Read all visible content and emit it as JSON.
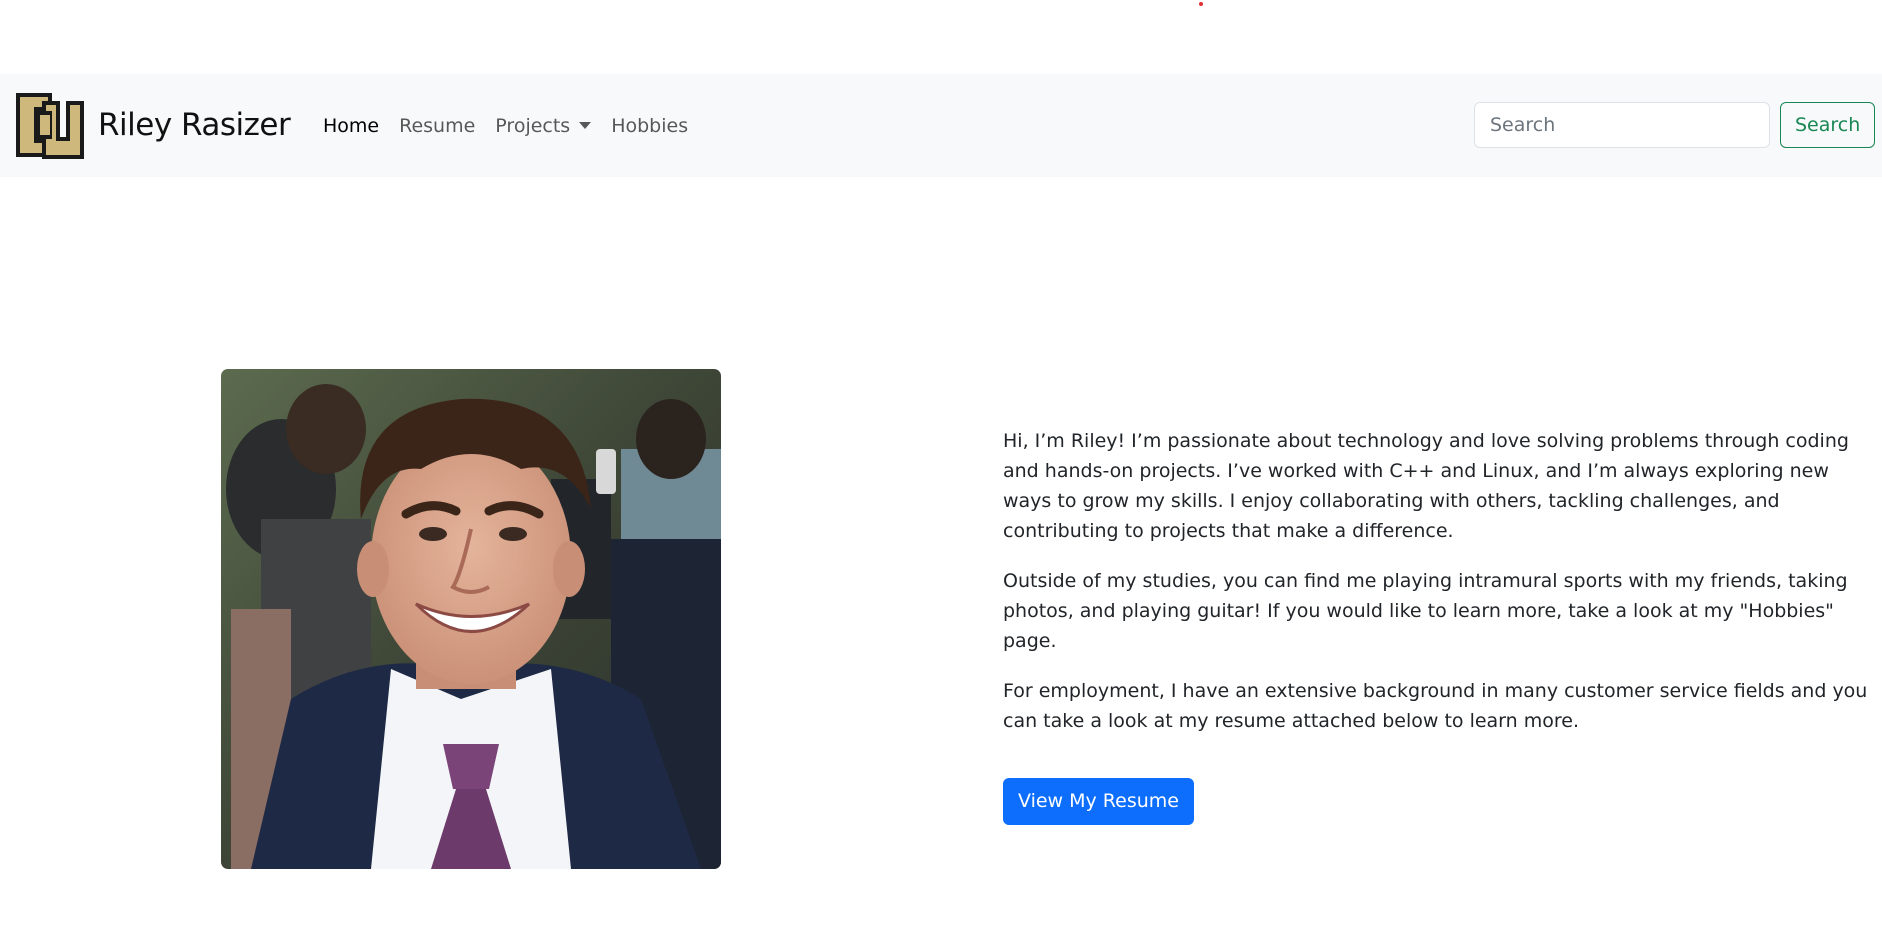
{
  "brand": {
    "name": "Riley Rasizer",
    "logo_icon": "cu-logo-icon"
  },
  "nav": {
    "items": [
      {
        "label": "Home",
        "active": true
      },
      {
        "label": "Resume",
        "active": false
      },
      {
        "label": "Projects",
        "active": false,
        "dropdown": true
      },
      {
        "label": "Hobbies",
        "active": false
      }
    ]
  },
  "search": {
    "placeholder": "Search",
    "value": "",
    "button_label": "Search"
  },
  "about": {
    "paragraphs": [
      "Hi, I’m Riley! I’m passionate about technology and love solving problems through coding and hands-on projects. I’ve worked with C++ and Linux, and I’m always exploring new ways to grow my skills. I enjoy collaborating with others, tackling challenges, and contributing to projects that make a difference.",
      "Outside of my studies, you can find me playing intramural sports with my friends, taking photos, and playing guitar! If you would like to learn more, take a look at my \"Hobbies\" page.",
      "For employment, I have an extensive background in many customer service fields and you can take a look at my resume attached below to learn more."
    ],
    "button_label": "View My Resume"
  },
  "colors": {
    "navbar_bg": "#f8f9fa",
    "primary": "#0d6efd",
    "success": "#198754",
    "logo_gold": "#cfb87c",
    "logo_dark": "#1a1a1a"
  }
}
